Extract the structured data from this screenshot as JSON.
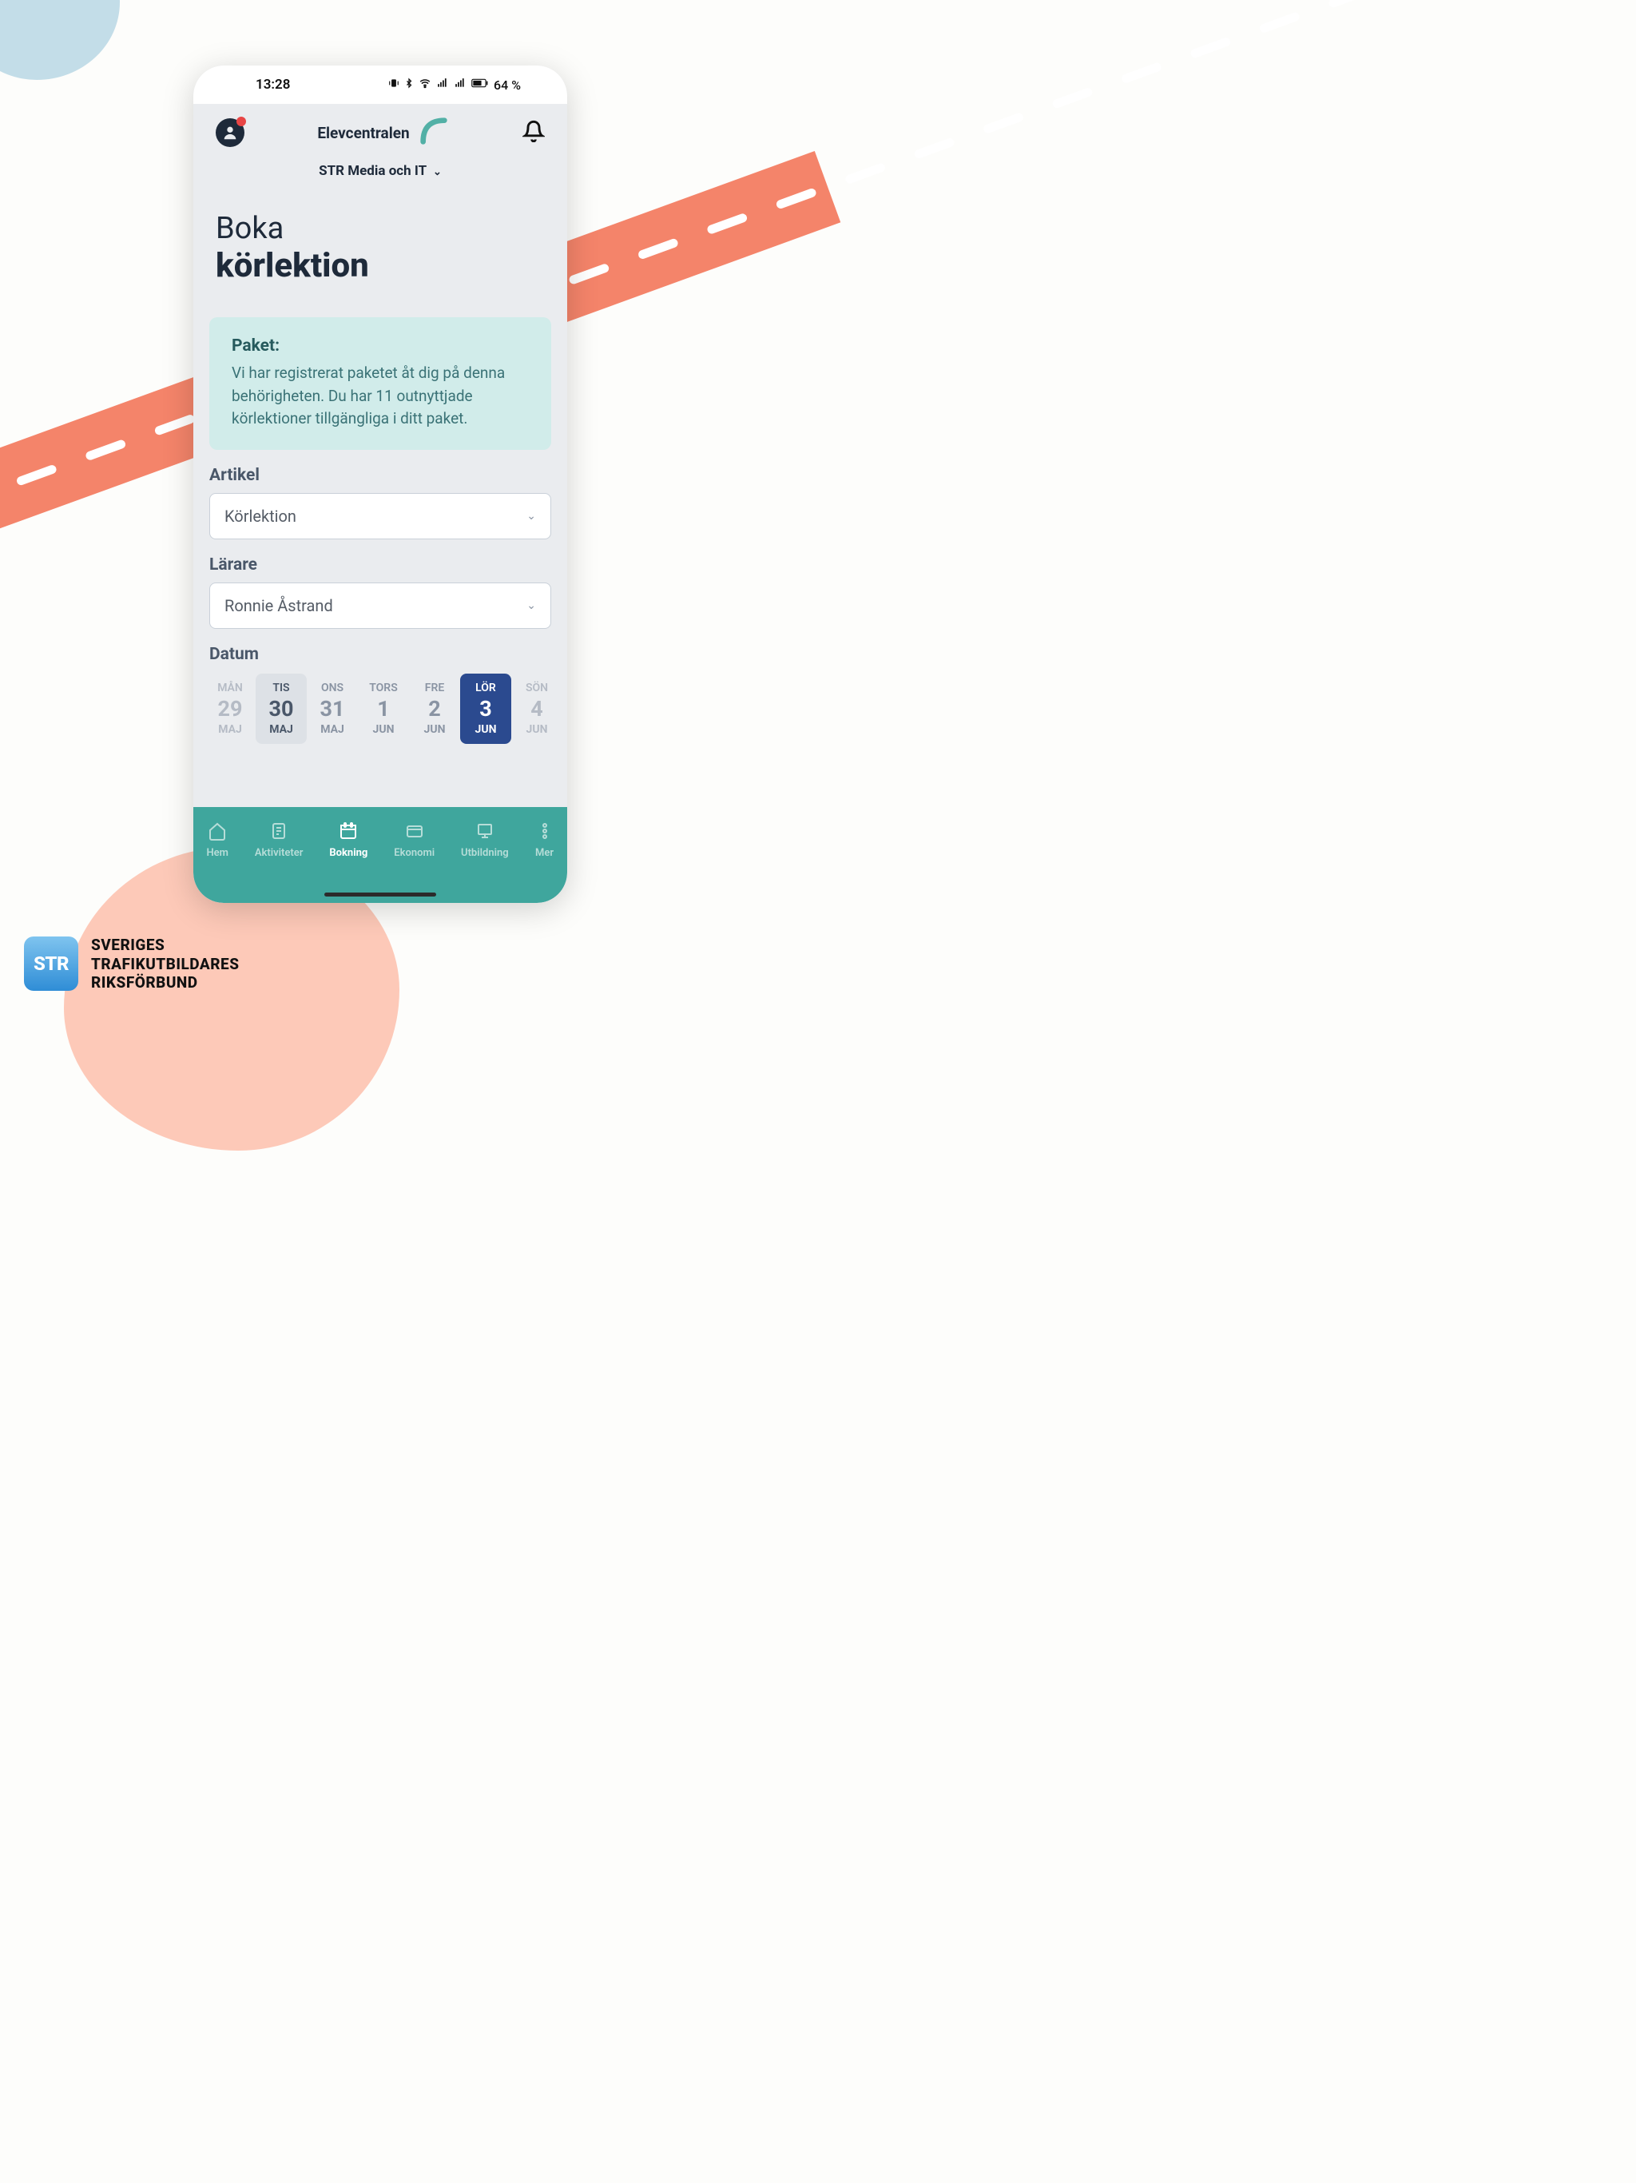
{
  "status": {
    "time": "13:28",
    "battery": "64 %"
  },
  "header": {
    "brand": "Elevcentralen",
    "school": "STR Media och IT"
  },
  "title": {
    "line1": "Boka",
    "line2": "körlektion"
  },
  "info": {
    "title": "Paket:",
    "body": "Vi har registrerat paketet åt dig på denna behörigheten. Du har 11 outnyttjade körlektioner tillgängliga i ditt paket."
  },
  "form": {
    "article_label": "Artikel",
    "article_value": "Körlektion",
    "teacher_label": "Lärare",
    "teacher_value": "Ronnie Åstrand",
    "date_label": "Datum"
  },
  "dates": [
    {
      "dow": "MÅN",
      "num": "29",
      "mon": "MAJ",
      "state": "faded"
    },
    {
      "dow": "TIS",
      "num": "30",
      "mon": "MAJ",
      "state": "today"
    },
    {
      "dow": "ONS",
      "num": "31",
      "mon": "MAJ",
      "state": ""
    },
    {
      "dow": "TORS",
      "num": "1",
      "mon": "JUN",
      "state": ""
    },
    {
      "dow": "FRE",
      "num": "2",
      "mon": "JUN",
      "state": ""
    },
    {
      "dow": "LÖR",
      "num": "3",
      "mon": "JUN",
      "state": "selected"
    },
    {
      "dow": "SÖN",
      "num": "4",
      "mon": "JUN",
      "state": "faded"
    }
  ],
  "nav": {
    "home": "Hem",
    "activities": "Aktiviteter",
    "booking": "Bokning",
    "economy": "Ekonomi",
    "education": "Utbildning",
    "more": "Mer"
  },
  "footer": {
    "logo": "STR",
    "line1": "SVERIGES",
    "line2": "TRAFIKUTBILDARES",
    "line3": "RIKSFÖRBUND"
  }
}
